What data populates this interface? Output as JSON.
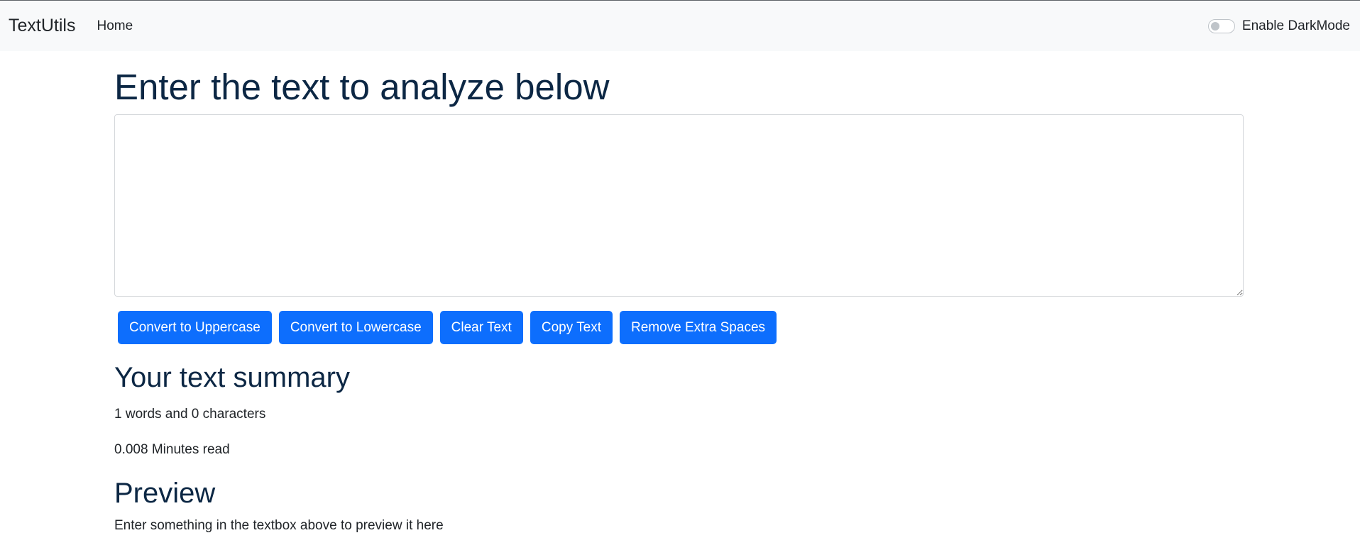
{
  "navbar": {
    "brand": "TextUtils",
    "links": [
      {
        "label": "Home"
      }
    ],
    "dark_mode": {
      "label": "Enable DarkMode",
      "enabled": false
    }
  },
  "main": {
    "heading": "Enter the text to analyze below",
    "textarea": {
      "value": "",
      "placeholder": ""
    },
    "buttons": [
      {
        "label": "Convert to Uppercase"
      },
      {
        "label": "Convert to Lowercase"
      },
      {
        "label": "Clear Text"
      },
      {
        "label": "Copy Text"
      },
      {
        "label": "Remove Extra Spaces"
      }
    ]
  },
  "summary": {
    "title": "Your text summary",
    "words_line": "1 words and 0 characters",
    "minutes_line": "0.008 Minutes read"
  },
  "preview": {
    "title": "Preview",
    "text": "Enter something in the textbox above to preview it here"
  },
  "colors": {
    "primary": "#0d6efd",
    "heading": "#0c2744",
    "navbar_bg": "#f8f9fa"
  }
}
